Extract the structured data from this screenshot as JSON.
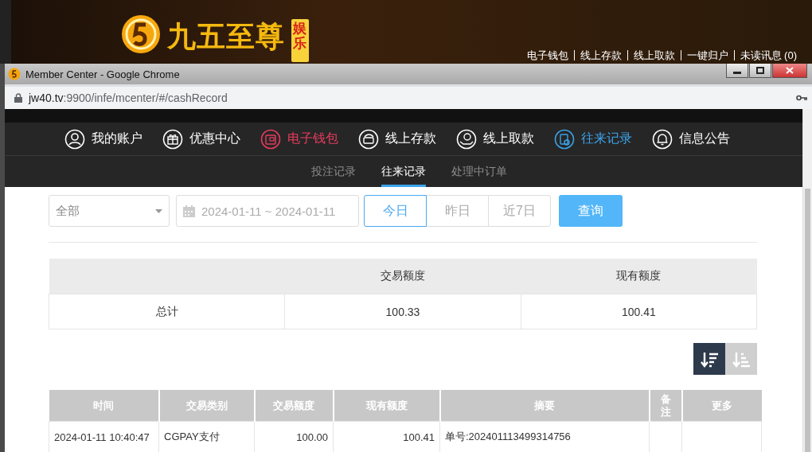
{
  "site": {
    "logo_text": "九五至尊",
    "logo_tag": "娱乐",
    "links": [
      "电子钱包",
      "线上存款",
      "线上取款",
      "一键归户",
      "未读讯息 (0)"
    ]
  },
  "window": {
    "title": "Member Center - Google Chrome",
    "url_host": "jw40.tv",
    "url_path": ":9900/infe/mcenter/#/cashRecord"
  },
  "nav": [
    {
      "label": "我的账户",
      "color": "#ffffff"
    },
    {
      "label": "优惠中心",
      "color": "#ffffff"
    },
    {
      "label": "电子钱包",
      "color": "#e83c5e"
    },
    {
      "label": "线上存款",
      "color": "#ffffff"
    },
    {
      "label": "线上取款",
      "color": "#ffffff"
    },
    {
      "label": "往来记录",
      "color": "#3ba3ea"
    },
    {
      "label": "信息公告",
      "color": "#ffffff"
    }
  ],
  "subtabs": [
    {
      "label": "投注记录",
      "selected": false
    },
    {
      "label": "往来记录",
      "selected": true
    },
    {
      "label": "处理中订单",
      "selected": false
    }
  ],
  "filters": {
    "type_select": "全部",
    "date_range": "2024-01-11 ~ 2024-01-11",
    "ranges": [
      {
        "label": "今日",
        "selected": true
      },
      {
        "label": "昨日",
        "selected": false
      },
      {
        "label": "近7日",
        "selected": false
      }
    ],
    "query_button": "查询"
  },
  "summary": {
    "columns": [
      "交易额度",
      "现有额度"
    ],
    "row": [
      "总计",
      "100.33",
      "100.41"
    ]
  },
  "sort_buttons": [
    {
      "kind": "desc",
      "selected": true
    },
    {
      "kind": "asc",
      "selected": false
    }
  ],
  "records": {
    "columns": [
      "时间",
      "交易类别",
      "交易额度",
      "现有额度",
      "摘要",
      "备注",
      "更多"
    ],
    "rows": [
      [
        "2024-01-11 10:40:47",
        "CGPAY支付",
        "100.00",
        "100.41",
        "单号:202401113499314756",
        "",
        ""
      ]
    ]
  }
}
